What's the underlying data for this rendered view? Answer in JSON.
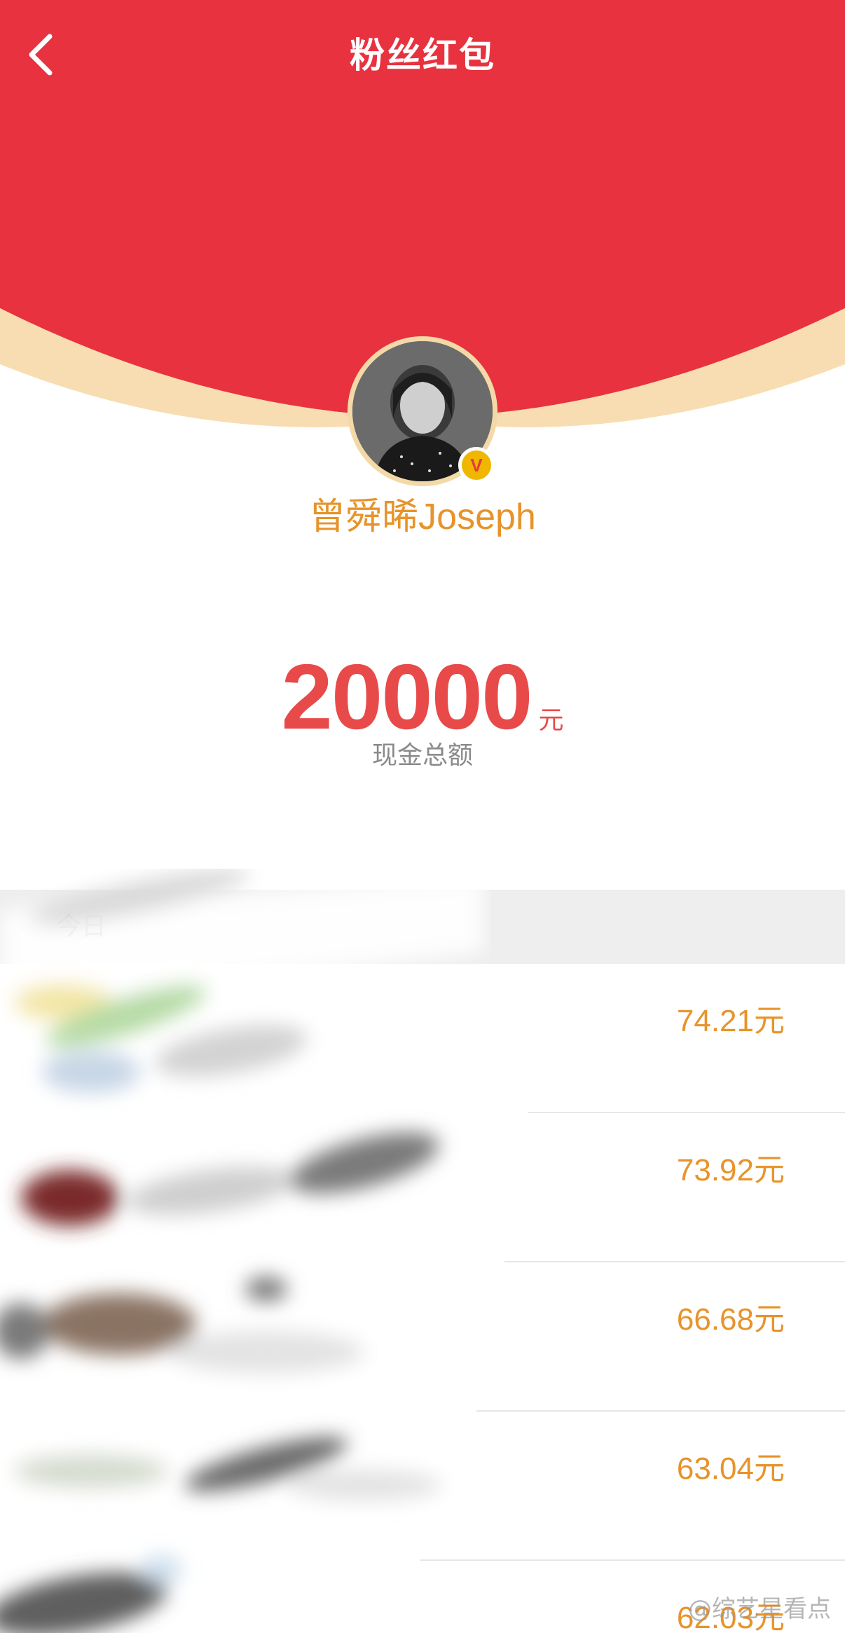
{
  "header": {
    "title": "粉丝红包",
    "back_icon": "chevron-left-icon",
    "bg_color": "#e8323f",
    "rim_color": "#f8ddb2"
  },
  "profile": {
    "username": "曾舜晞Joseph",
    "verified_badge": "V"
  },
  "summary": {
    "amount": "20000",
    "unit": "元",
    "caption": "现金总额",
    "accent_color": "#e84a4a"
  },
  "section": {
    "label": "今日"
  },
  "list": {
    "items": [
      {
        "amount": "74.21元"
      },
      {
        "amount": "73.92元"
      },
      {
        "amount": "66.68元"
      },
      {
        "amount": "63.04元"
      },
      {
        "amount": "62.03元"
      }
    ],
    "amount_color": "#e8932a"
  },
  "watermark": "@综艺星看点"
}
